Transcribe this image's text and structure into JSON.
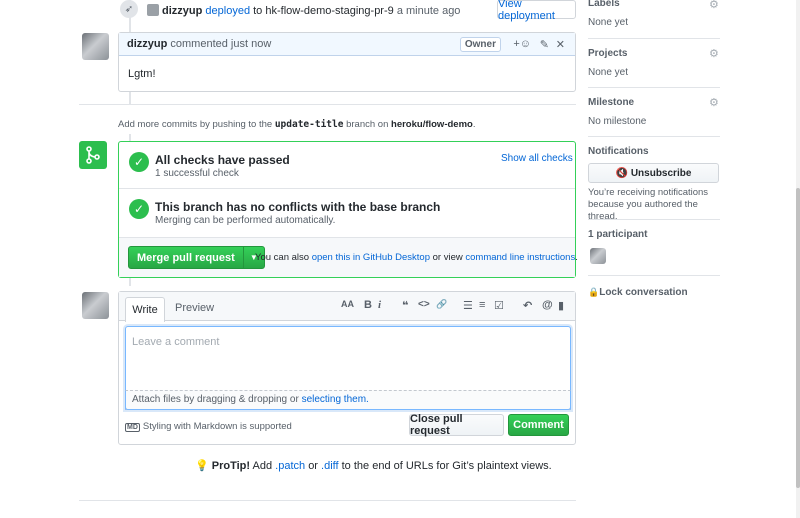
{
  "deploy": {
    "user": "dizzyup",
    "action": "deployed",
    "to": "to",
    "environment": "hk-flow-demo-staging-pr-9",
    "time": "a minute ago",
    "button": "View deployment"
  },
  "comment": {
    "author": "dizzyup",
    "meta": "commented just now",
    "badge": "Owner",
    "body": "Lgtm!"
  },
  "commits_hint": {
    "prefix": "Add more commits by pushing to the",
    "branch": "update-title",
    "mid": "branch on",
    "repo": "heroku/flow-demo",
    "suffix": "."
  },
  "checks": {
    "title": "All checks have passed",
    "subtitle": "1 successful check",
    "show_all": "Show all checks"
  },
  "conflicts": {
    "title": "This branch has no conflicts with the base branch",
    "subtitle": "Merging can be performed automatically."
  },
  "merge": {
    "button": "Merge pull request",
    "hint_prefix": "You can also",
    "desktop_link": "open this in GitHub Desktop",
    "hint_mid": "or view",
    "cli_link": "command line instructions",
    "hint_suffix": "."
  },
  "editor": {
    "tab_write": "Write",
    "tab_preview": "Preview",
    "toolbar": {
      "heading": "AA",
      "bold": "B",
      "italic": "i",
      "quote": "❝",
      "code": "<>",
      "link": "🔗",
      "ul": "☰",
      "ol": "≡",
      "tasks": "☑",
      "reply": "↶",
      "mention": "@",
      "bookmark": "▮"
    },
    "placeholder": "Leave a comment",
    "attach_prefix": "Attach files by dragging & dropping or",
    "attach_link": "selecting them.",
    "markdown_icon": "MD",
    "markdown_note": "Styling with Markdown is supported",
    "close_button": "Close pull request",
    "comment_button": "Comment"
  },
  "protip": {
    "label": "ProTip!",
    "text1": "Add",
    "patch": ".patch",
    "or": "or",
    "diff": ".diff",
    "text2": "to the end of URLs for Git’s plaintext views."
  },
  "sidebar": {
    "labels": {
      "title": "Labels",
      "value": "None yet"
    },
    "projects": {
      "title": "Projects",
      "value": "None yet"
    },
    "milestone": {
      "title": "Milestone",
      "value": "No milestone"
    },
    "notifications": {
      "title": "Notifications",
      "button": "Unsubscribe",
      "reason": "You’re receiving notifications because you authored the thread."
    },
    "participants": {
      "title": "1 participant"
    },
    "lock": {
      "label": "Lock conversation"
    }
  },
  "colors": {
    "success": "#2cbe4e",
    "link": "#0366d6",
    "header_bg": "#f1f8ff"
  }
}
